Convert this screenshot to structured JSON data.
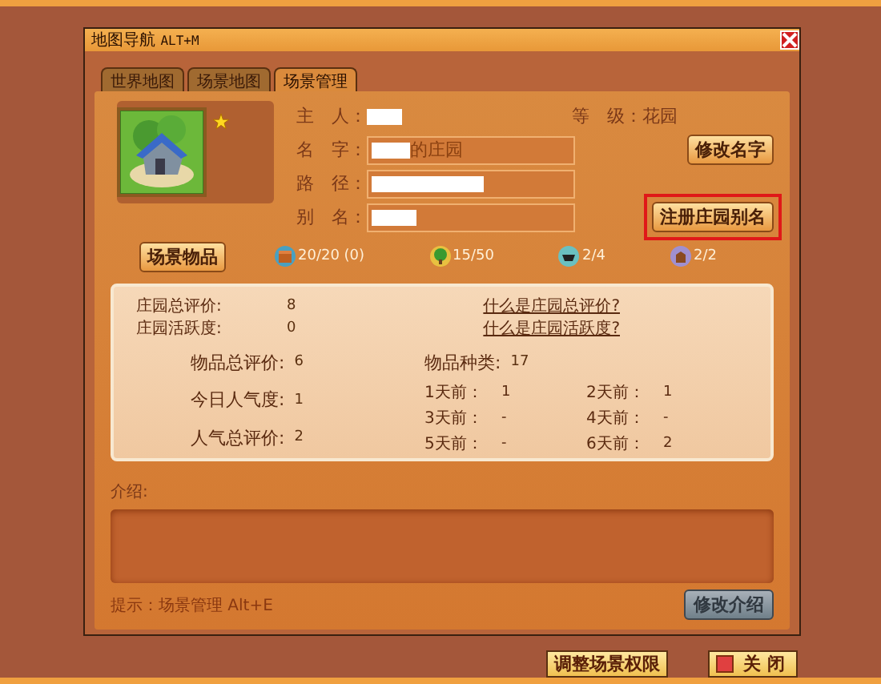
{
  "window": {
    "title": "地图导航",
    "shortcut": "ALT+M"
  },
  "tabs": [
    {
      "label": "世界地图",
      "selected": false
    },
    {
      "label": "场景地图",
      "selected": false
    },
    {
      "label": "场景管理",
      "selected": true
    }
  ],
  "profile": {
    "starred": true,
    "owner_label": "主　人：",
    "level_label": "等　级：",
    "level_value": "花园",
    "fields": [
      {
        "label": "名　字：",
        "value": "的庄园"
      },
      {
        "label": "路　径："
      },
      {
        "label": "别　名："
      }
    ],
    "rename_button": {
      "label": "修改名字"
    },
    "alias_button": {
      "label": "注册庄园别名",
      "highlighted": true
    },
    "items_button": {
      "label": "场景物品"
    }
  },
  "counters": [
    {
      "kind": "chest",
      "value": "20/20 (0)"
    },
    {
      "kind": "tree",
      "value": "15/50"
    },
    {
      "kind": "pot",
      "value": "2/4"
    },
    {
      "kind": "animal",
      "value": "2/2"
    }
  ],
  "stats": {
    "rating_label": "庄园总评价:",
    "rating": "8",
    "activity_label": "庄园活跃度:",
    "activity": "0",
    "rating_help": "什么是庄园总评价?",
    "activity_help": "什么是庄园活跃度?",
    "item_rating_label": "物品总评价:",
    "item_rating": "6",
    "item_kinds_label": "物品种类:",
    "item_kinds": "17",
    "today_label": "今日人气度:",
    "today": "1",
    "total_pop_label": "人气总评价:",
    "total_pop": "2",
    "history": [
      {
        "label": "1天前：",
        "value": "1"
      },
      {
        "label": "2天前：",
        "value": "1"
      },
      {
        "label": "3天前：",
        "value": "-"
      },
      {
        "label": "4天前：",
        "value": "-"
      },
      {
        "label": "5天前：",
        "value": "-"
      },
      {
        "label": "6天前：",
        "value": "2"
      }
    ]
  },
  "intro": {
    "label": "介绍:",
    "edit_button": "修改介绍"
  },
  "hint": "提示：场景管理 Alt+E",
  "footer": {
    "permissions_button": "调整场景权限",
    "close_button": "关 闭"
  }
}
